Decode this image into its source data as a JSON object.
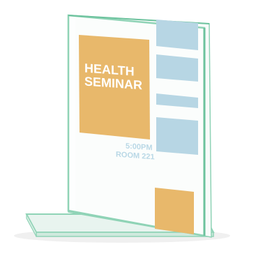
{
  "sign": {
    "headline_line1": "HEALTH",
    "headline_line2": "SEMINAR",
    "time": "5:00PM",
    "room": "ROOM 221"
  },
  "colors": {
    "background": "#ffffff",
    "acrylic_edge": "#8fd3b6",
    "acrylic_fill": "#f7fbfa",
    "base_fill": "#e8f4ef",
    "panel_orange": "#e8b86b",
    "panel_blue": "#b7d6e4",
    "headline_text": "#ffffff",
    "info_text": "#b9d8e6"
  },
  "product": {
    "type": "T-style acrylic sign holder",
    "icon": "sign-holder-icon"
  }
}
